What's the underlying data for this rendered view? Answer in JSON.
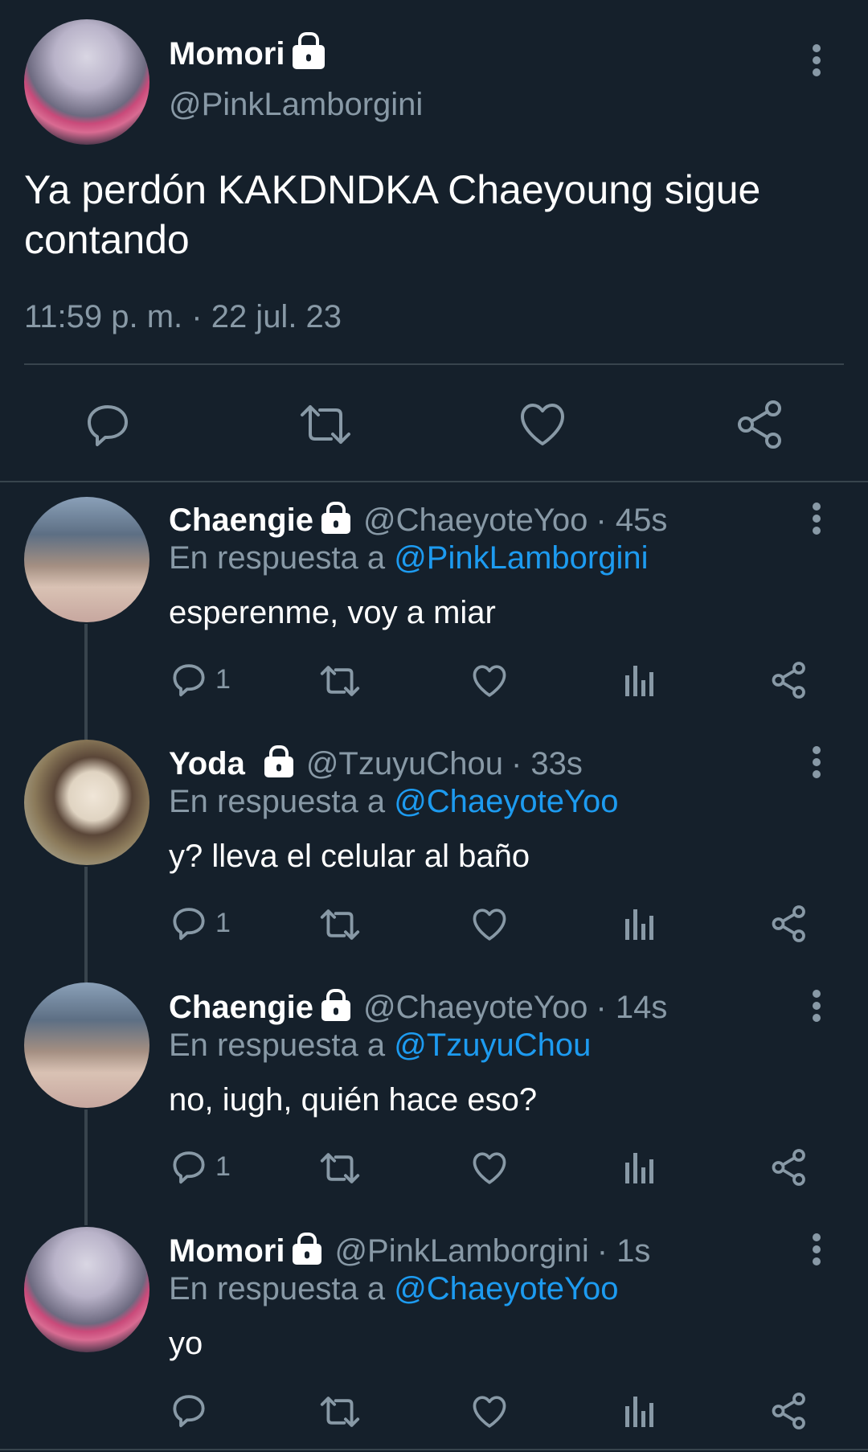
{
  "main_tweet": {
    "name": "Momori",
    "handle": "@PinkLamborgini",
    "text": "Ya perdón KAKDNDKA Chaeyoung sigue contando",
    "timestamp": "11:59 p. m. · 22 jul. 23"
  },
  "replies": [
    {
      "name": "Chaengie",
      "handle": "@ChaeyoteYoo",
      "time": "· 45s",
      "reply_prefix": "En respuesta a",
      "reply_to": "@PinkLamborgini",
      "text": "esperenme, voy a miar",
      "reply_count": "1"
    },
    {
      "name": "Yoda",
      "handle": "@TzuyuChou",
      "time": "· 33s",
      "reply_prefix": "En respuesta a",
      "reply_to": "@ChaeyoteYoo",
      "text": "y? lleva el celular al baño",
      "reply_count": "1"
    },
    {
      "name": "Chaengie",
      "handle": "@ChaeyoteYoo",
      "time": "· 14s",
      "reply_prefix": "En respuesta a",
      "reply_to": "@TzuyuChou",
      "text": "no, iugh, quién hace eso?",
      "reply_count": "1"
    },
    {
      "name": "Momori",
      "handle": "@PinkLamborgini",
      "time": "· 1s",
      "reply_prefix": "En respuesta a",
      "reply_to": "@ChaeyoteYoo",
      "text": "yo",
      "reply_count": ""
    }
  ],
  "colors": {
    "background": "#15202b",
    "secondary_text": "#8899a6",
    "accent": "#1d9bf0",
    "divider": "#38444d"
  }
}
